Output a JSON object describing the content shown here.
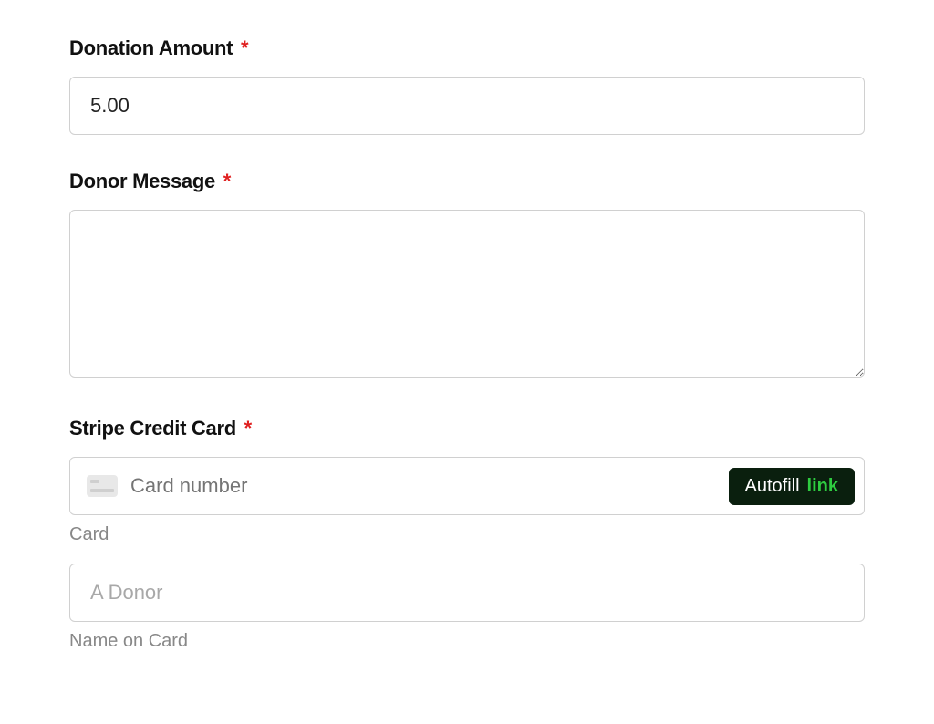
{
  "donationAmount": {
    "label": "Donation Amount",
    "required": "*",
    "value": "5.00"
  },
  "donorMessage": {
    "label": "Donor Message",
    "required": "*",
    "value": ""
  },
  "stripeCard": {
    "label": "Stripe Credit Card",
    "required": "*",
    "cardNumber": {
      "placeholder": "Card number",
      "helper": "Card"
    },
    "autofill": {
      "text": "Autofill",
      "linkText": "link"
    },
    "nameOnCard": {
      "placeholder": "A Donor",
      "helper": "Name on Card"
    }
  }
}
